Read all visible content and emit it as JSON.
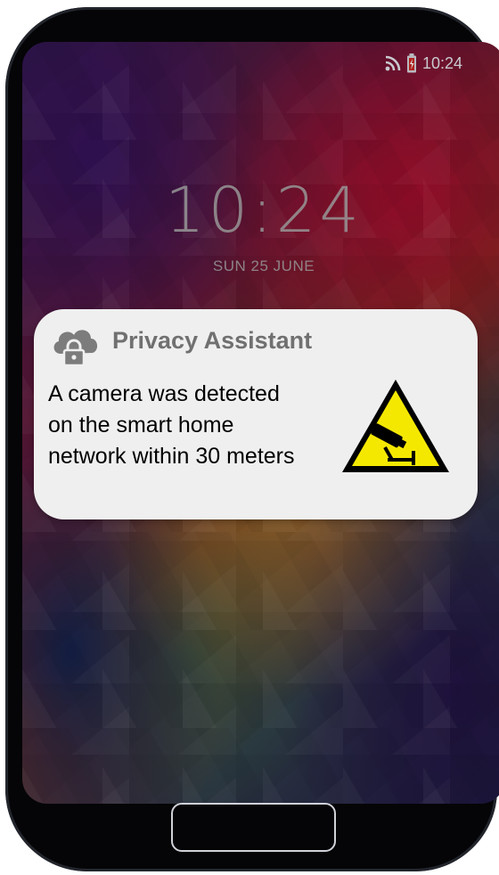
{
  "status_bar": {
    "time": "10:24",
    "wifi_icon": "wifi-icon",
    "battery_icon": "battery-icon"
  },
  "lock_screen": {
    "time": "10:24",
    "date": "SUN 25 JUNE"
  },
  "notification": {
    "app_icon": "cloud-lock-icon",
    "app_name": "Privacy Assistant",
    "body_lines": [
      "A camera was detected",
      "on the smart home",
      "network within 30 meters"
    ],
    "alert_icon": "camera-warning-icon"
  },
  "home_button": {
    "icon": "home-button"
  },
  "colors": {
    "notification_bg": "#efefef",
    "warning_yellow": "#f5e800",
    "app_name_gray": "#707070"
  }
}
